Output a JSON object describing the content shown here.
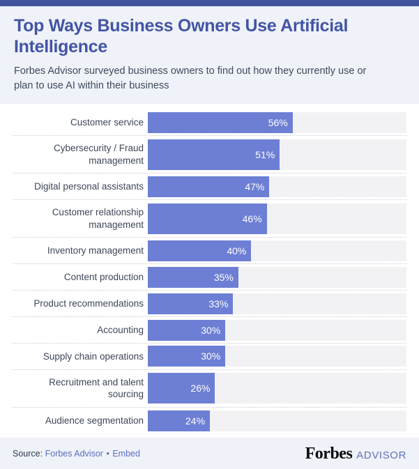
{
  "header": {
    "title": "Top Ways Business Owners Use Artificial Intelligence",
    "subtitle": "Forbes Advisor surveyed business owners to find out how they currently use or plan to use AI within their business"
  },
  "footer": {
    "source_prefix": "Source:",
    "source_name": "Forbes Advisor",
    "separator": "•",
    "embed_label": "Embed",
    "brand_primary": "Forbes",
    "brand_secondary": "ADVISOR"
  },
  "colors": {
    "top_accent": "#41549C",
    "header_bg": "#EFF2F8",
    "title": "#4254A5",
    "subtitle": "#3E4A5C",
    "bar_fill": "#6D7FD4",
    "bar_track": "#F2F2F4",
    "label": "#3D4758",
    "link": "#5B6FC4"
  },
  "chart_data": {
    "type": "bar",
    "orientation": "horizontal",
    "title": "Top Ways Business Owners Use Artificial Intelligence",
    "subtitle": "Forbes Advisor surveyed business owners to find out how they currently use or plan to use AI within their business",
    "xlabel": "",
    "ylabel": "",
    "xlim": [
      0,
      100
    ],
    "unit": "%",
    "grid": false,
    "legend": false,
    "categories": [
      "Customer service",
      "Cybersecurity / Fraud management",
      "Digital personal assistants",
      "Customer relationship management",
      "Inventory management",
      "Content production",
      "Product recommendations",
      "Accounting",
      "Supply chain operations",
      "Recruitment and talent sourcing",
      "Audience segmentation"
    ],
    "values": [
      56,
      51,
      47,
      46,
      40,
      35,
      33,
      30,
      30,
      26,
      24
    ],
    "value_labels": [
      "56%",
      "51%",
      "47%",
      "46%",
      "40%",
      "35%",
      "33%",
      "30%",
      "30%",
      "26%",
      "24%"
    ]
  },
  "rows": [
    {
      "label": "Customer service",
      "value_label": "56%",
      "value": 56,
      "two_line": false
    },
    {
      "label": "Cybersecurity / Fraud\nmanagement",
      "value_label": "51%",
      "value": 51,
      "two_line": true
    },
    {
      "label": "Digital personal assistants",
      "value_label": "47%",
      "value": 47,
      "two_line": false
    },
    {
      "label": "Customer relationship\nmanagement",
      "value_label": "46%",
      "value": 46,
      "two_line": true
    },
    {
      "label": "Inventory management",
      "value_label": "40%",
      "value": 40,
      "two_line": false
    },
    {
      "label": "Content production",
      "value_label": "35%",
      "value": 35,
      "two_line": false
    },
    {
      "label": "Product recommendations",
      "value_label": "33%",
      "value": 33,
      "two_line": false
    },
    {
      "label": "Accounting",
      "value_label": "30%",
      "value": 30,
      "two_line": false
    },
    {
      "label": "Supply chain operations",
      "value_label": "30%",
      "value": 30,
      "two_line": false
    },
    {
      "label": "Recruitment and talent\nsourcing",
      "value_label": "26%",
      "value": 26,
      "two_line": true
    },
    {
      "label": "Audience segmentation",
      "value_label": "24%",
      "value": 24,
      "two_line": false
    }
  ]
}
